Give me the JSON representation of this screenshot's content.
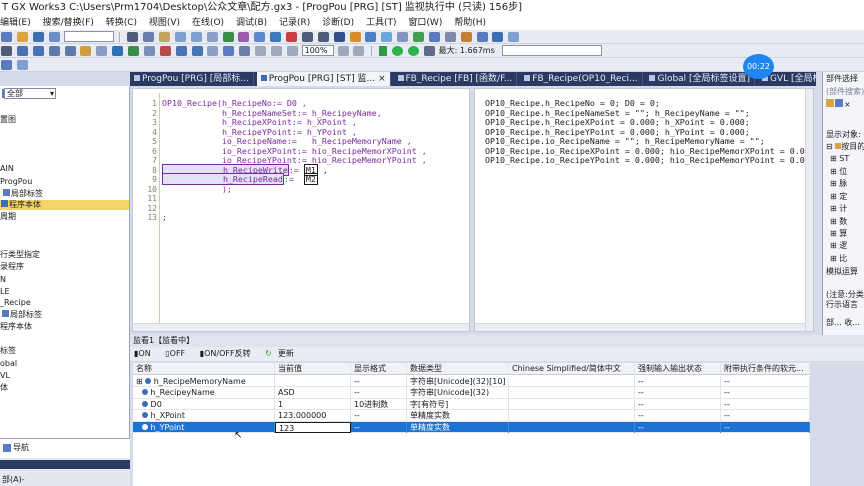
{
  "window": {
    "title": "T GX Works3 C:\\Users\\Prm1704\\Desktop\\公众文章\\配方.gx3 - [ProgPou [PRG] [ST] 监视执行中 (只读) 156步]"
  },
  "menu": {
    "items": [
      "编辑(E)",
      "搜索/替换(F)",
      "转换(C)",
      "视图(V)",
      "在线(O)",
      "调试(B)",
      "记录(R)",
      "诊断(D)",
      "工具(T)",
      "窗口(W)",
      "帮助(H)"
    ]
  },
  "toolbar": {
    "zoom": "100%",
    "max_label": "最大:",
    "max_value": "1.667ms"
  },
  "left": {
    "combo": "全部",
    "items": [
      "置图",
      "AIN",
      "ProgPou",
      "局部标签",
      "程序本体",
      "周期",
      "行类型指定",
      "录程序",
      "N",
      "LE",
      "_Recipe",
      "局部标签",
      "程序本体",
      "标签",
      "obal",
      "VL",
      "体"
    ],
    "nav_label": "导航",
    "bottom_label": "部(A)-"
  },
  "tabs": [
    "ProgPou [PRG] [局部标...",
    "ProgPou [PRG] [ST] 监...",
    "FB_Recipe [FB] [函数/F...",
    "FB_Recipe(OP10_Reci...",
    "Global [全局标签设置]",
    "GVL [全局标签设..."
  ],
  "clock": "00:22",
  "editor": {
    "line_numbers": [
      "1",
      "2",
      "3",
      "4",
      "5",
      "6",
      "7",
      "8",
      "9",
      "10",
      "11",
      "12",
      "13"
    ],
    "lines": [
      "OP10_Recipe(h_RecipeNo:= D0 ,",
      "            h_RecipeNameSet:= h_RecipeyName,",
      "            h_RecipeXPoint:= h_XPoint ,",
      "            h_RecipeYPoint:= h_YPoint ,",
      "            io_RecipeName:=   h_RecipeMemoryName ,",
      "            io_RecipeXPoint:= hio_RecipeMemorXPoint ,",
      "            io_RecipeYPoint:= hio_RecipeMemorYPoint ,",
      "            h_RecipeWrite",
      "            h_RecipeRead",
      "            );",
      "",
      "",
      ";"
    ],
    "write_suffix": ":= ",
    "write_val": "M1",
    "read_suffix": ":=  ",
    "read_val": "M2",
    "monitor": [
      "OP10_Recipe.h_RecipeNo = 0; D0 = 0;",
      "OP10_Recipe.h_RecipeNameSet = \"\"; h_RecipeyName = \"\";",
      "OP10_Recipe.h_RecipeXPoint = 0.000; h_XPoint = 0.000;",
      "OP10_Recipe.h_RecipeYPoint = 0.000; h_YPoint = 0.000;",
      "OP10_Recipe.io_RecipeName = \"\"; h_RecipeMemoryName = \"\";",
      "OP10_Recipe.io_RecipeXPoint = 0.000; hio_RecipeMemorXPoint = 0.000;",
      "OP10_Recipe.io_RecipeYPoint = 0.000; hio_RecipeMemorYPoint = 0.000;"
    ]
  },
  "right": {
    "title": "部件选择",
    "search": "(部件搜索)",
    "display_label": "显示对象:",
    "tree": [
      "按目的",
      "ST",
      "位",
      "脉",
      "定",
      "计",
      "数",
      "算",
      "逻",
      "比"
    ],
    "section": "模拟运算",
    "note1": "(注意:分类",
    "note2": "行示语言",
    "tab1": "部...",
    "tab2": "收..."
  },
  "watch": {
    "title": "监看1【监看中】",
    "toolbar": [
      "ON",
      "OFF",
      "ON/OFF反转",
      "更新"
    ],
    "headers": [
      "名称",
      "当前值",
      "显示格式",
      "数据类型",
      "Chinese Simplified/简体中文",
      "强制输入输出状态",
      "附带执行条件的软元..."
    ],
    "rows": [
      {
        "name": "h_RecipeMemoryName",
        "value": "",
        "fmt": "--",
        "type": "字符串[Unicode](32)[10]",
        "cn": "",
        "force": "--",
        "cond": "--"
      },
      {
        "name": "h_RecipeyName",
        "value": "ASD",
        "fmt": "--",
        "type": "字符串[Unicode](32)",
        "cn": "",
        "force": "--",
        "cond": "--"
      },
      {
        "name": "D0",
        "value": "1",
        "fmt": "10进制数",
        "type": "字[有符号]",
        "cn": "",
        "force": "--",
        "cond": "--"
      },
      {
        "name": "h_XPoint",
        "value": "123.000000",
        "fmt": "--",
        "type": "单精度实数",
        "cn": "",
        "force": "--",
        "cond": "--"
      },
      {
        "name": "h_YPoint",
        "value": "123",
        "fmt": "--",
        "type": "单精度实数",
        "cn": "",
        "force": "--",
        "cond": "--"
      }
    ]
  },
  "colors": {
    "tabbar": "#2b3a63",
    "selection": "#1c73d6",
    "keyword": "#7b2a9b",
    "clock": "#1f86f0"
  }
}
